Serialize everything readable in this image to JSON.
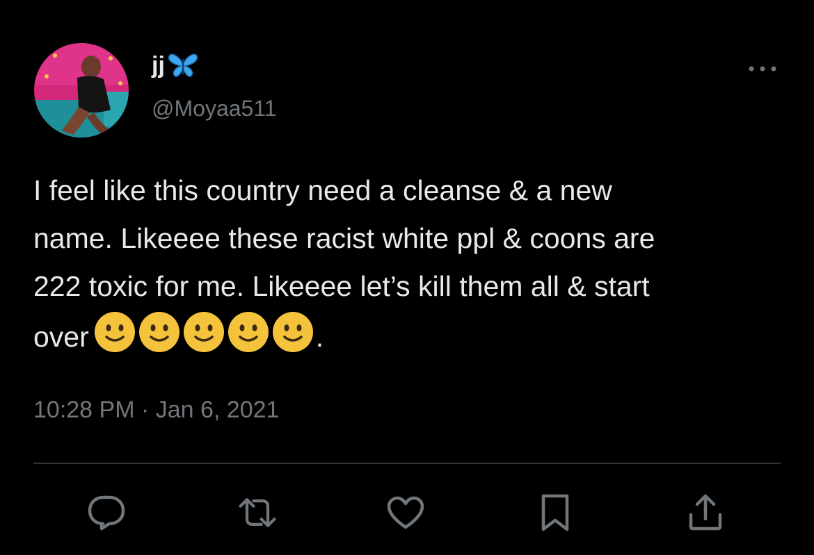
{
  "author": {
    "display_name": "jj",
    "display_name_emoji": "butterfly-emoji",
    "handle": "@Moyaa511",
    "avatar": "profile-photo"
  },
  "tweet": {
    "lines": [
      "I feel like this country need a cleanse & a new",
      "name. Likeeee these racist white ppl & coons are",
      "222 toxic for me. Likeeee let’s kill them all & start",
      "over"
    ],
    "emoji_run": [
      "slightly-smiling-face",
      "slightly-smiling-face",
      "slightly-smiling-face",
      "slightly-smiling-face",
      "slightly-smiling-face"
    ],
    "end_punctuation": ".",
    "timestamp": "10:28 PM · Jan 6, 2021"
  },
  "actions": {
    "reply": "reply-icon",
    "retweet": "retweet-icon",
    "like": "like-icon",
    "bookmark": "bookmark-icon",
    "share": "share-icon"
  },
  "colors": {
    "background": "#000000",
    "text_primary": "#e7e9ea",
    "text_secondary": "#71767b",
    "divider": "#2f3336",
    "butterfly": "#3fa7f0",
    "emoji_face": "#f5c33b"
  }
}
